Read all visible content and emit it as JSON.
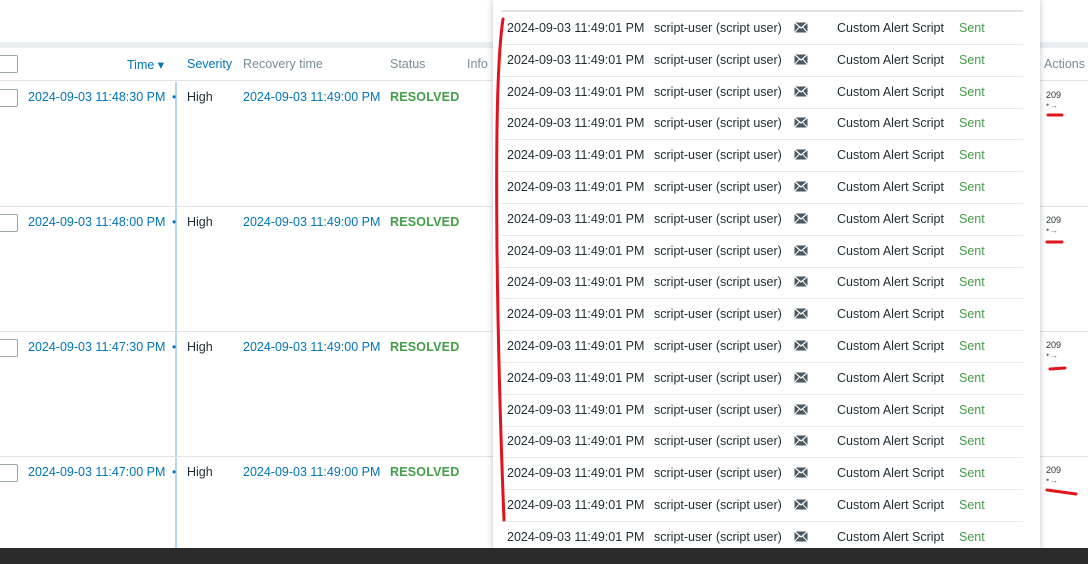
{
  "table": {
    "headers": {
      "time": "Time ▾",
      "severity": "Severity",
      "recovery_time": "Recovery time",
      "status": "Status",
      "info": "Info",
      "actions": "Actions"
    },
    "rows": [
      {
        "time": "2024-09-03 11:48:30 PM",
        "severity": "High",
        "recovery_time": "2024-09-03 11:49:00 PM",
        "status": "RESOLVED",
        "actions_count": "209"
      },
      {
        "time": "2024-09-03 11:48:00 PM",
        "severity": "High",
        "recovery_time": "2024-09-03 11:49:00 PM",
        "status": "RESOLVED",
        "actions_count": "209"
      },
      {
        "time": "2024-09-03 11:47:30 PM",
        "severity": "High",
        "recovery_time": "2024-09-03 11:49:00 PM",
        "status": "RESOLVED",
        "actions_count": "209"
      },
      {
        "time": "2024-09-03 11:47:00 PM",
        "severity": "High",
        "recovery_time": "2024-09-03 11:49:00 PM",
        "status": "RESOLVED",
        "actions_count": "209"
      }
    ]
  },
  "popup": {
    "icon": "envelope-icon",
    "rows": [
      {
        "time": "2024-09-03 11:49:01 PM",
        "user": "script-user (script user)",
        "media": "Custom Alert Script",
        "status": "Sent"
      },
      {
        "time": "2024-09-03 11:49:01 PM",
        "user": "script-user (script user)",
        "media": "Custom Alert Script",
        "status": "Sent"
      },
      {
        "time": "2024-09-03 11:49:01 PM",
        "user": "script-user (script user)",
        "media": "Custom Alert Script",
        "status": "Sent"
      },
      {
        "time": "2024-09-03 11:49:01 PM",
        "user": "script-user (script user)",
        "media": "Custom Alert Script",
        "status": "Sent"
      },
      {
        "time": "2024-09-03 11:49:01 PM",
        "user": "script-user (script user)",
        "media": "Custom Alert Script",
        "status": "Sent"
      },
      {
        "time": "2024-09-03 11:49:01 PM",
        "user": "script-user (script user)",
        "media": "Custom Alert Script",
        "status": "Sent"
      },
      {
        "time": "2024-09-03 11:49:01 PM",
        "user": "script-user (script user)",
        "media": "Custom Alert Script",
        "status": "Sent"
      },
      {
        "time": "2024-09-03 11:49:01 PM",
        "user": "script-user (script user)",
        "media": "Custom Alert Script",
        "status": "Sent"
      },
      {
        "time": "2024-09-03 11:49:01 PM",
        "user": "script-user (script user)",
        "media": "Custom Alert Script",
        "status": "Sent"
      },
      {
        "time": "2024-09-03 11:49:01 PM",
        "user": "script-user (script user)",
        "media": "Custom Alert Script",
        "status": "Sent"
      },
      {
        "time": "2024-09-03 11:49:01 PM",
        "user": "script-user (script user)",
        "media": "Custom Alert Script",
        "status": "Sent"
      },
      {
        "time": "2024-09-03 11:49:01 PM",
        "user": "script-user (script user)",
        "media": "Custom Alert Script",
        "status": "Sent"
      },
      {
        "time": "2024-09-03 11:49:01 PM",
        "user": "script-user (script user)",
        "media": "Custom Alert Script",
        "status": "Sent"
      },
      {
        "time": "2024-09-03 11:49:01 PM",
        "user": "script-user (script user)",
        "media": "Custom Alert Script",
        "status": "Sent"
      },
      {
        "time": "2024-09-03 11:49:01 PM",
        "user": "script-user (script user)",
        "media": "Custom Alert Script",
        "status": "Sent"
      },
      {
        "time": "2024-09-03 11:49:01 PM",
        "user": "script-user (script user)",
        "media": "Custom Alert Script",
        "status": "Sent"
      },
      {
        "time": "2024-09-03 11:49:01 PM",
        "user": "script-user (script user)",
        "media": "Custom Alert Script",
        "status": "Sent"
      }
    ]
  },
  "colors": {
    "link": "#0275b8",
    "resolved": "#429e47",
    "annotation": "#e0141e"
  }
}
